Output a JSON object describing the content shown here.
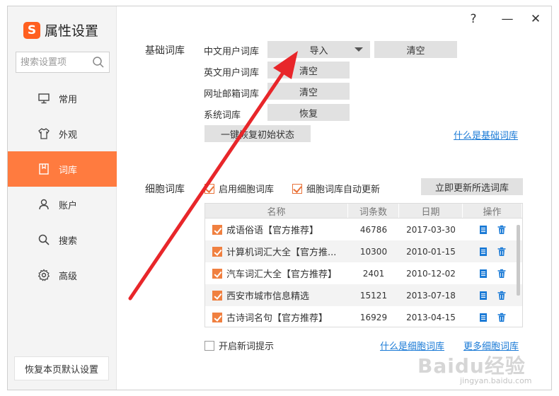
{
  "brand": {
    "logo": "S",
    "title": "属性设置"
  },
  "search": {
    "placeholder": "搜索设置项"
  },
  "window_controls": {
    "help": "?",
    "minimize": "—",
    "close": "✕"
  },
  "nav": [
    {
      "id": "general",
      "label": "常用",
      "icon": "monitor-icon",
      "active": false
    },
    {
      "id": "appearance",
      "label": "外观",
      "icon": "tshirt-icon",
      "active": false
    },
    {
      "id": "dictionary",
      "label": "词库",
      "icon": "book-icon",
      "active": true
    },
    {
      "id": "account",
      "label": "账户",
      "icon": "user-icon",
      "active": false
    },
    {
      "id": "search",
      "label": "搜索",
      "icon": "search-icon",
      "active": false
    },
    {
      "id": "advanced",
      "label": "高级",
      "icon": "gear-icon",
      "active": false
    }
  ],
  "restore_default_label": "恢复本页默认设置",
  "basic": {
    "section_label": "基础词库",
    "rows": [
      {
        "label": "中文用户词库",
        "primary": "导入",
        "secondary": "清空"
      },
      {
        "label": "英文用户词库",
        "primary": "清空"
      },
      {
        "label": "网址邮箱词库",
        "primary": "清空"
      },
      {
        "label": "系统词库",
        "primary": "恢复"
      }
    ],
    "reset_all": "一键恢复初始状态",
    "help_link": "什么是基础词库"
  },
  "cell": {
    "section_label": "细胞词库",
    "enable_label": "启用细胞词库",
    "enable_checked": true,
    "auto_update_label": "细胞词库自动更新",
    "auto_update_checked": true,
    "update_selected": "立即更新所选词库",
    "columns": [
      "名称",
      "词条数",
      "日期",
      "操作"
    ],
    "rows": [
      {
        "name": "成语俗语【官方推荐】",
        "count": "46786",
        "date": "2017-03-30",
        "checked": true
      },
      {
        "name": "计算机词汇大全【官方推...",
        "count": "10300",
        "date": "2010-01-15",
        "checked": true
      },
      {
        "name": "汽车词汇大全【官方推荐】",
        "count": "2401",
        "date": "2010-12-02",
        "checked": true
      },
      {
        "name": "西安市城市信息精选",
        "count": "15121",
        "date": "2013-07-18",
        "checked": true
      },
      {
        "name": "古诗词名句【官方推荐】",
        "count": "16929",
        "date": "2013-04-15",
        "checked": true
      }
    ],
    "new_word_hint_label": "开启新词提示",
    "new_word_hint_checked": false,
    "help_link": "什么是细胞词库",
    "more_link": "更多细胞词库"
  },
  "watermark": {
    "main": "Baidu经验",
    "sub": "jingyan.baidu.com"
  },
  "colors": {
    "accent": "#ff7b3f",
    "link": "#1a7ad6",
    "arrow": "#e8262a",
    "button": "#e1e1e1"
  }
}
